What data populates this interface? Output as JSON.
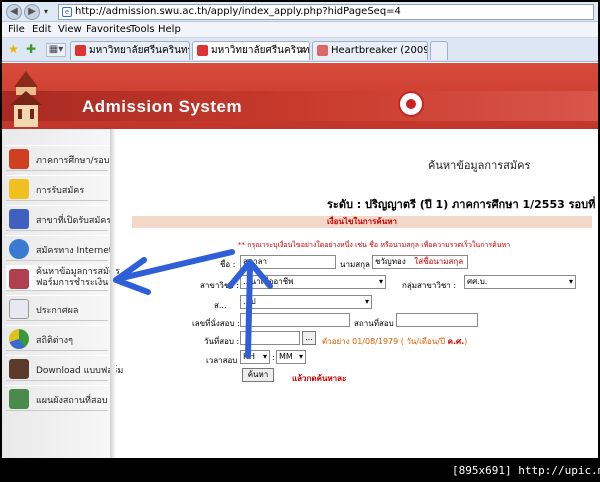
{
  "browser": {
    "url": "http://admission.swu.ac.th/apply/index_apply.php?hidPageSeq=4",
    "menu": [
      "File",
      "Edit",
      "View",
      "Favorites",
      "Tools",
      "Help"
    ],
    "tabs": [
      {
        "label": "มหาวิทยาลัยศรีนครินทรวิโร..."
      },
      {
        "label": "มหาวิทยาลัยศรีนครินทรวิ..."
      },
      {
        "label": "Heartbreaker (2009) ★ ..."
      }
    ]
  },
  "header": {
    "title": "Admission System"
  },
  "sidebar": {
    "items": [
      {
        "label": "ภาคการศึกษา/รอบ"
      },
      {
        "label": "การรับสมัคร"
      },
      {
        "label": "สาขาที่เปิดรับสมัคร"
      },
      {
        "label": "สมัครทาง Internet"
      },
      {
        "label": "ค้นหาข้อมูลการสมัคร",
        "label2": "ฟอร์มการชำระเงิน"
      },
      {
        "label": "ประกาศผล"
      },
      {
        "label": "สถิติต่างๆ"
      },
      {
        "label": "Download แบบฟอร์ม"
      },
      {
        "label": "แผนผังสถานที่สอบ"
      }
    ]
  },
  "main": {
    "title": "ค้นหาข้อมูลการสมัคร",
    "level": "ระดับ : ปริญญาตรี (ปี 1) ภาคการศึกษา 1/2553 รอบที่ 1",
    "condition_title": "เงื่อนไขในการค้นหา",
    "note": "** กรุณาระบุเงื่อนไขอย่างใดอย่างหนึ่ง เช่น ชื่อ หรือนามสกุล เพื่อความรวดเร็วในการค้นหา",
    "fields": {
      "first_name_label": "ชื่อ :",
      "first_name_value": "สุดาลา",
      "last_name_label": "นามสกุล :",
      "last_name_value": "ชวัญทอง",
      "last_name_hint": "ใส่ชื่อนามสกุล",
      "major_label": "สาขาวิชา :",
      "major_value": "...นาเพื่ออาชีพ",
      "major_group_label": "กลุ่มสาขาวิชา :",
      "major_group_value": "ศศ.บ.",
      "field4_label": "ส...",
      "field4_value": "...ป",
      "exam_no_label": "เลขที่นั่งสอบ :",
      "exam_place_label": "สถานที่สอบ :",
      "exam_date_label": "วันที่สอบ :",
      "date_button": "...",
      "date_example": "ตัวอย่าง 01/08/1979 ( วัน/เดือน/ปี ",
      "date_example_bold": "ค.ศ.",
      "date_example_end": ")",
      "exam_time_label": "เวลาสอบ :",
      "hour": "HH",
      "minute": "MM",
      "search_button": "ค้นหา",
      "after_hint": "แล้วกดค้นหาละ"
    }
  },
  "watermark": "[895x691] http://upic.me/",
  "colors": {
    "banner": "#c8382c",
    "sidebar_bg": "#eeeeee",
    "arrow": "#2f5fd8",
    "condition_bar": "#f3d7c9"
  }
}
